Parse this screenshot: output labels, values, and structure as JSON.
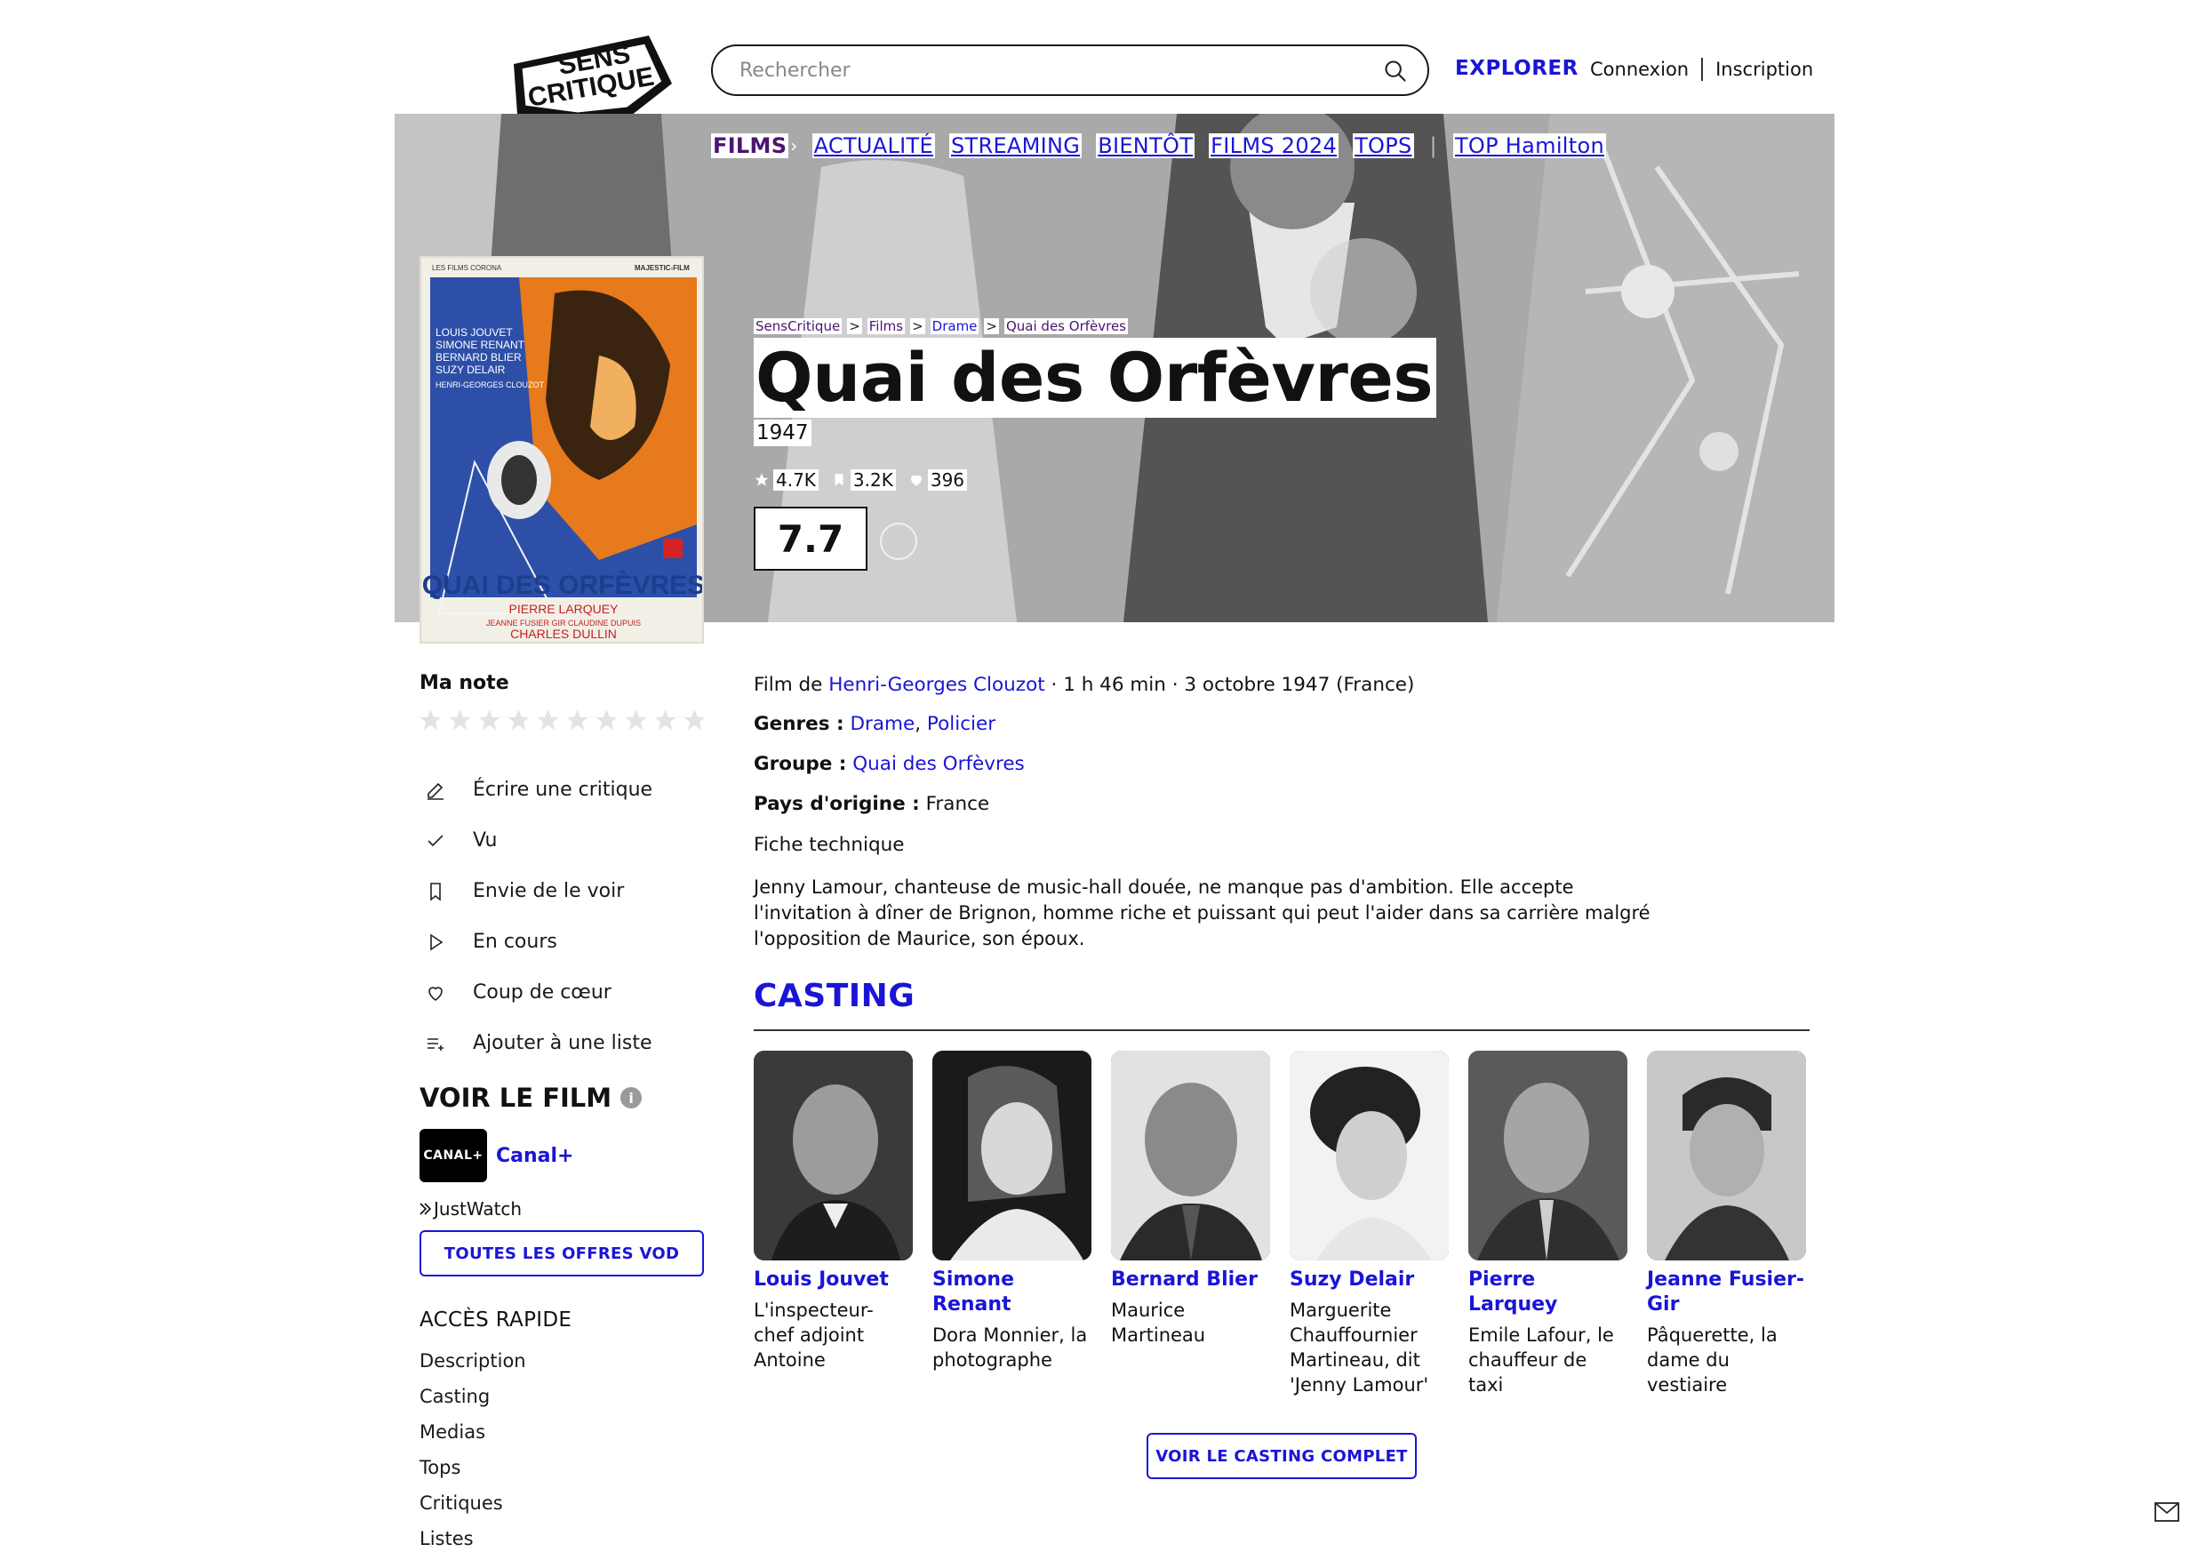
{
  "header": {
    "logo_text_line1": "SENS",
    "logo_text_line2": "CRITIQUE",
    "search_placeholder": "Rechercher",
    "explore_label": "EXPLORER",
    "login_label": "Connexion",
    "signup_label": "Inscription"
  },
  "nav": {
    "films": "FILMS",
    "items": [
      "ACTUALITÉ",
      "STREAMING",
      "BIENTÔT",
      "FILMS 2024",
      "TOPS"
    ],
    "top_link": "TOP Hamilton"
  },
  "breadcrumb": [
    "SensCritique",
    "Films",
    "Drame",
    "Quai des Orfèvres"
  ],
  "film": {
    "title": "Quai des Orfèvres",
    "year": "1947",
    "stats": {
      "ratings": "4.7K",
      "wishlist": "3.2K",
      "favorites": "396"
    },
    "score": "7.7",
    "director_prefix": "Film de",
    "director": "Henri-Georges Clouzot",
    "details": "· 1 h 46 min · 3 octobre 1947 (France)",
    "genres_label": "Genres :",
    "genres": [
      "Drame",
      "Policier"
    ],
    "group_label": "Groupe :",
    "group": "Quai des Orfèvres",
    "country_label": "Pays d'origine :",
    "country": "France",
    "fiche_label": "Fiche technique",
    "synopsis": "Jenny Lamour, chanteuse de music-hall douée, ne manque pas d'ambition. Elle accepte l'invitation à dîner de Brignon, homme riche et puissant qui peut l'aider dans sa carrière malgré l'opposition de Maurice, son époux."
  },
  "poster": {
    "top_line": "LES FILMS CORONA",
    "production": "MAJESTIC-FILM",
    "actors": [
      "LOUIS JOUVET",
      "SIMONE RENANT",
      "BERNARD BLIER",
      "SUZY DELAIR",
      "HENRI-GEORGES CLOUZOT"
    ],
    "title": "QUAI DES ORFÈVRES",
    "bottom_lines": [
      "PIERRE LARQUEY",
      "JEANNE FUSIER GIR  CLAUDINE DUPUIS",
      "CHARLES DULLIN"
    ]
  },
  "sidebar": {
    "rating_label": "Ma note",
    "actions": [
      "Écrire une critique",
      "Vu",
      "Envie de le voir",
      "En cours",
      "Coup de cœur",
      "Ajouter à une liste"
    ],
    "watch_title": "VOIR LE FILM",
    "provider_logo": "CANAL+",
    "provider_name": "Canal+",
    "justwatch": "JustWatch",
    "vod_button": "TOUTES LES OFFRES VOD",
    "quick_access_title": "ACCÈS RAPIDE",
    "quick_access": [
      "Description",
      "Casting",
      "Medias",
      "Tops",
      "Critiques",
      "Listes"
    ]
  },
  "casting": {
    "title": "CASTING",
    "members": [
      {
        "name": "Louis Jouvet",
        "role": "L'inspecteur-chef adjoint Antoine"
      },
      {
        "name": "Simone Renant",
        "role": "Dora Monnier, la photographe"
      },
      {
        "name": "Bernard Blier",
        "role": "Maurice Martineau"
      },
      {
        "name": "Suzy Delair",
        "role": "Marguerite Chauffournier Martineau, dit 'Jenny Lamour'"
      },
      {
        "name": "Pierre Larquey",
        "role": "Emile Lafour, le chauffeur de taxi"
      },
      {
        "name": "Jeanne Fusier-Gir",
        "role": "Pâquerette, la dame du vestiaire"
      }
    ],
    "button": "VOIR LE CASTING COMPLET"
  },
  "colors": {
    "accent": "#1a15d6",
    "films_nav": "#4b1570",
    "text": "#111111"
  }
}
